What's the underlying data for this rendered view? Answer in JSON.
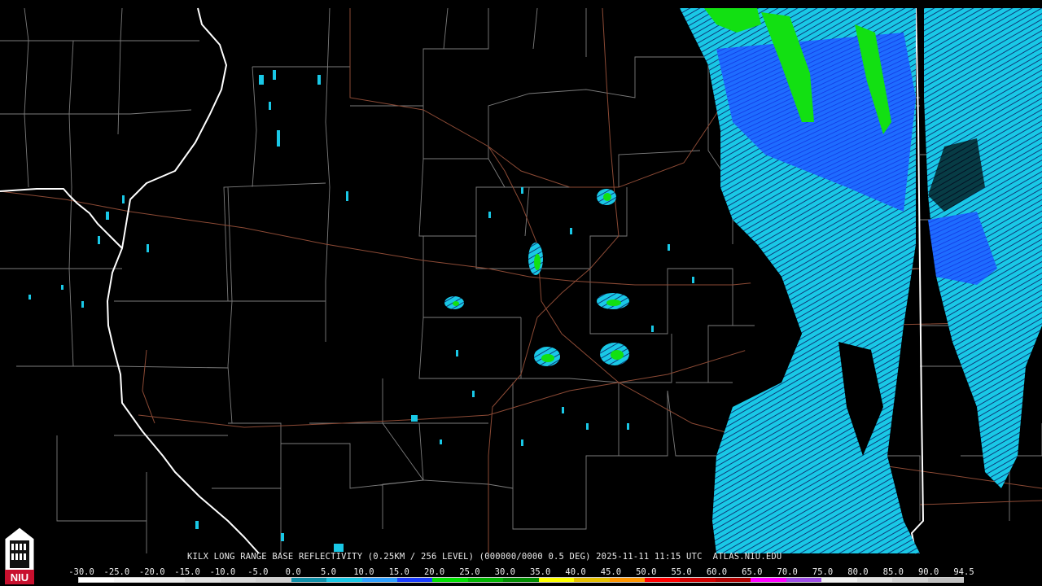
{
  "product": {
    "caption": "KILX LONG RANGE BASE REFLECTIVITY (0.25KM / 256 LEVEL) (000000/0000 0.5 DEG) 2025-11-11 11:15 UTC  ATLAS.NIU.EDU",
    "logo_text": "NIU"
  },
  "scale": {
    "labels": [
      "-30.0",
      "-25.0",
      "-20.0",
      "-15.0",
      "-10.0",
      "-5.0",
      "0.0",
      "5.0",
      "10.0",
      "15.0",
      "20.0",
      "25.0",
      "30.0",
      "35.0",
      "40.0",
      "45.0",
      "50.0",
      "55.0",
      "60.0",
      "65.0",
      "70.0",
      "75.0",
      "80.0",
      "85.0",
      "90.0",
      "94.5"
    ],
    "colors": [
      "#ffffff",
      "#f6f6f6",
      "#ececec",
      "#e2e2e2",
      "#d8d8d8",
      "#cfcfcf",
      "#0f8fa8",
      "#19c8e6",
      "#2ea0ff",
      "#1a3cff",
      "#00e000",
      "#00b400",
      "#008c00",
      "#ffff00",
      "#e6c000",
      "#ff9600",
      "#ff0000",
      "#d20000",
      "#b00000",
      "#ff00ff",
      "#9e4ee6",
      "#f0f0f0",
      "#e0e0e0",
      "#d0d0d0",
      "#c0c0c0"
    ]
  },
  "colors": {
    "background": "#000000",
    "county_lines": "#7c7c7c",
    "state_lines": "#ffffff",
    "highways": "#8c4a35",
    "echo_light": "#19c8e6",
    "echo_mid": "#1e6cff",
    "echo_heavy": "#1030e0",
    "echo_green": "#12e012"
  }
}
